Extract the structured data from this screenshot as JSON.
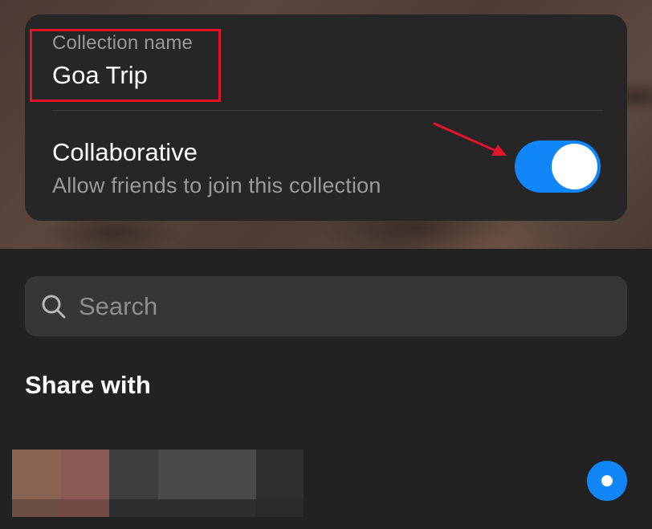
{
  "collection": {
    "name_label": "Collection name",
    "name_value": "Goa Trip"
  },
  "collaborative": {
    "title": "Collaborative",
    "subtitle": "Allow friends to join this collection",
    "enabled": true
  },
  "search": {
    "placeholder": "Search",
    "icon": "search-icon"
  },
  "share": {
    "title": "Share with",
    "contacts": [
      {
        "avatar": "avatar",
        "selected": true
      }
    ]
  },
  "colors": {
    "accent": "#1186f8",
    "annotation": "#e3142a",
    "card": "#262626",
    "background": "#222222"
  }
}
